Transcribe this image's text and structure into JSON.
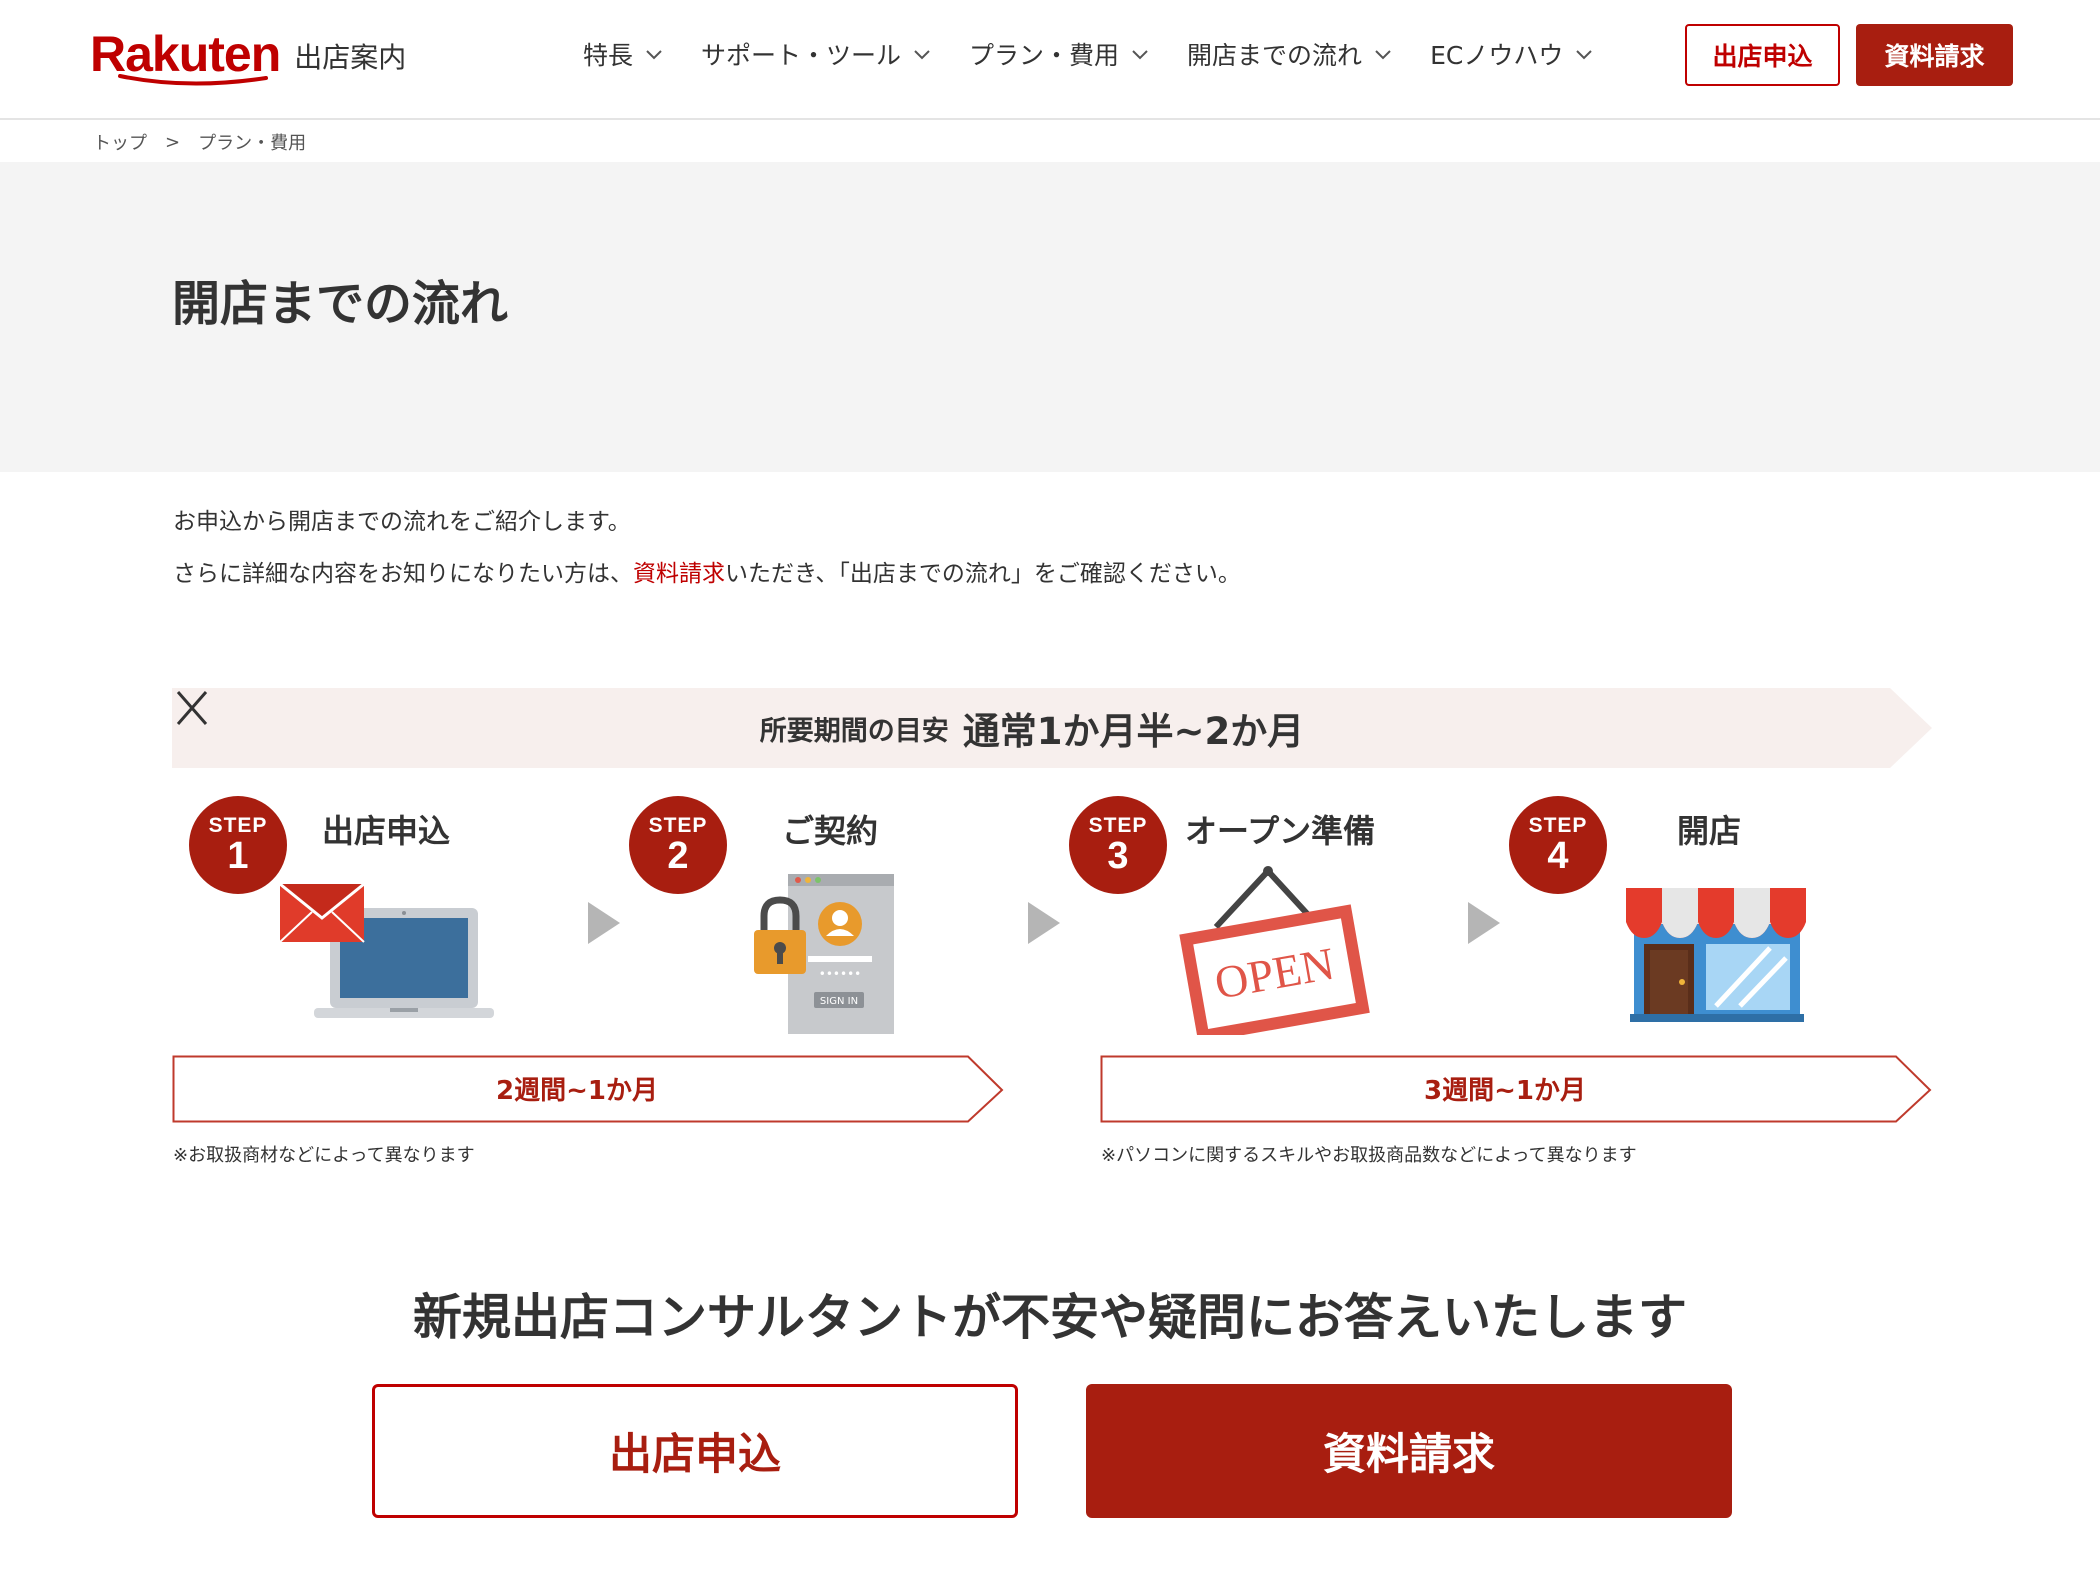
{
  "header": {
    "logo_word": "Rakuten",
    "logo_sub": "出店案内",
    "nav": [
      {
        "label": "特長"
      },
      {
        "label": "サポート・ツール"
      },
      {
        "label": "プラン・費用"
      },
      {
        "label": "開店までの流れ"
      },
      {
        "label": "ECノウハウ"
      }
    ],
    "apply_label": "出店申込",
    "docs_label": "資料請求"
  },
  "breadcrumb": {
    "home": "トップ",
    "separator": ">",
    "current": "プラン・費用"
  },
  "page_title": "開店までの流れ",
  "intro": {
    "line1": "お申込から開店までの流れをご紹介します。",
    "line2_before": "さらに詳細な内容をお知りになりたい方は、",
    "line2_link": "資料請求",
    "line2_after": "いただき、「出店までの流れ」をご確認ください。"
  },
  "duration": {
    "label": "所要期間の目安",
    "value": "通常1か月半~2か月"
  },
  "steps": [
    {
      "step_word": "STEP",
      "number": "1",
      "title": "出店申込",
      "icon": "laptop-mail-icon"
    },
    {
      "step_word": "STEP",
      "number": "2",
      "title": "ご契約",
      "icon": "signin-lock-icon"
    },
    {
      "step_word": "STEP",
      "number": "3",
      "title": "オープン準備",
      "icon": "open-sign-icon"
    },
    {
      "step_word": "STEP",
      "number": "4",
      "title": "開店",
      "icon": "storefront-icon"
    }
  ],
  "phases": [
    {
      "label": "2週間~1か月",
      "note": "※お取扱商材などによって異なります"
    },
    {
      "label": "3週間~1か月",
      "note": "※パソコンに関するスキルやお取扱商品数などによって異なります"
    }
  ],
  "consult": {
    "heading": "新規出店コンサルタントが不安や疑問にお答えいたします",
    "apply_label": "出店申込",
    "docs_label": "資料請求"
  },
  "colors": {
    "brand_red": "#bf0000",
    "button_red": "#a81e10",
    "band_gray": "#f4f4f4",
    "duration_bg": "#f7efed"
  }
}
